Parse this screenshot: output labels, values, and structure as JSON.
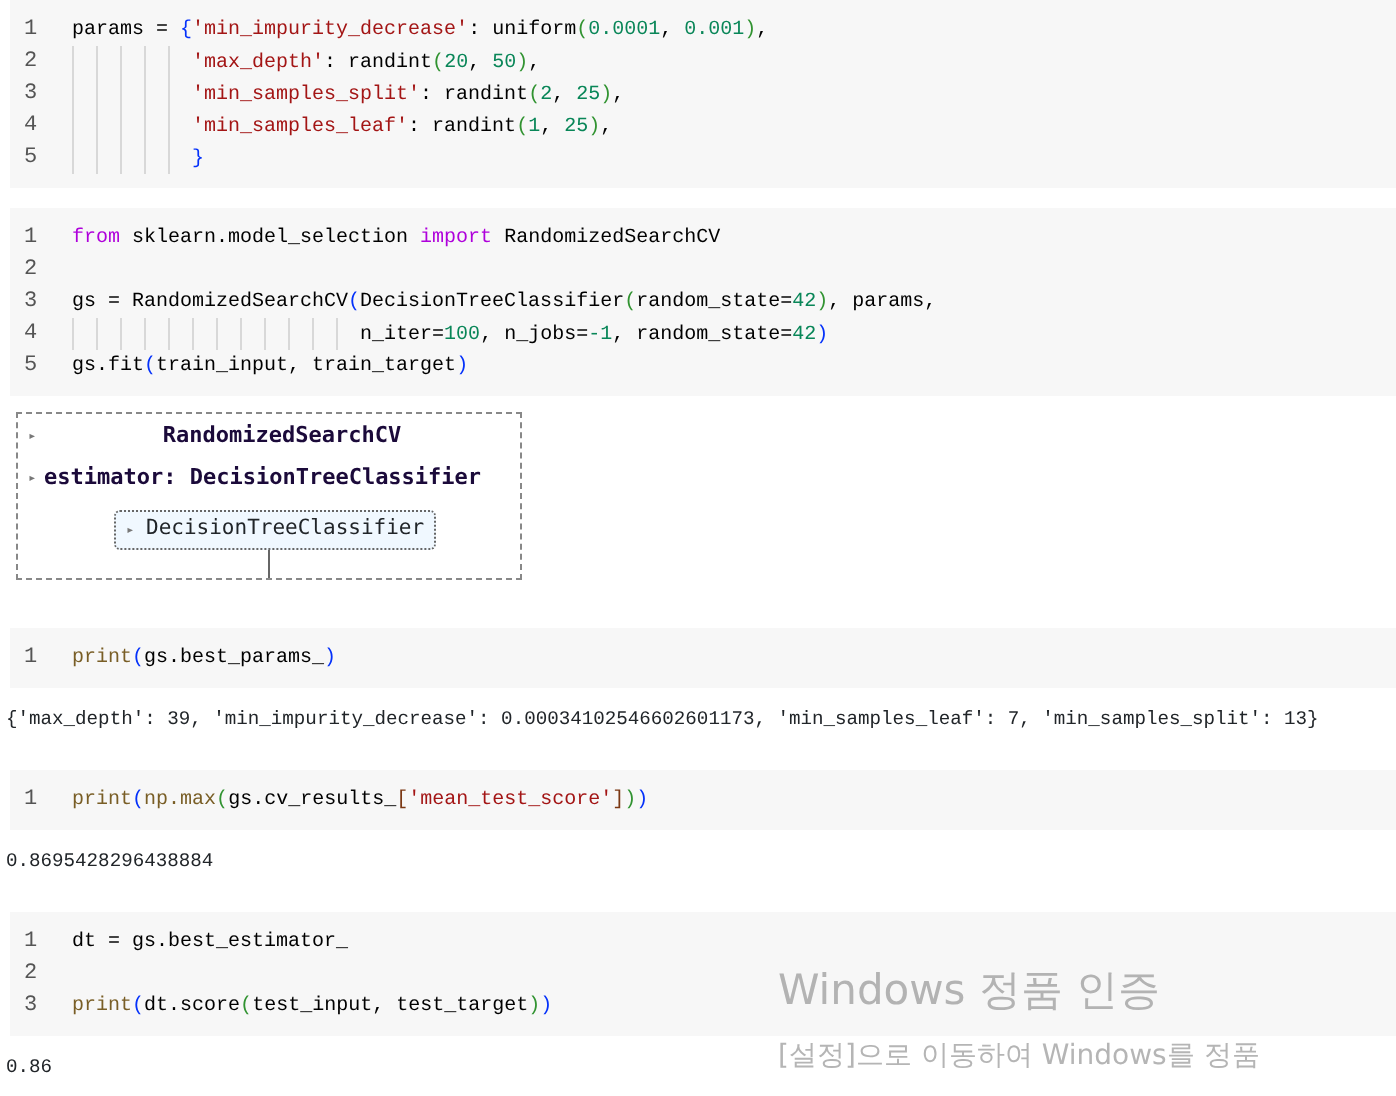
{
  "cells": [
    {
      "kind": "code",
      "lines": [
        {
          "num": "1",
          "tokens": [
            {
              "t": "params = ",
              "kind": "plain"
            },
            {
              "t": "{",
              "kind": "p1"
            },
            {
              "t": "'min_impurity_decrease'",
              "kind": "str"
            },
            {
              "t": ": uniform",
              "kind": "plain"
            },
            {
              "t": "(",
              "kind": "p2"
            },
            {
              "t": "0.0001",
              "kind": "num"
            },
            {
              "t": ", ",
              "kind": "plain"
            },
            {
              "t": "0.001",
              "kind": "num"
            },
            {
              "t": ")",
              "kind": "p2"
            },
            {
              "t": ",",
              "kind": "plain"
            }
          ]
        },
        {
          "num": "2",
          "tokens": [
            {
              "t": "          'max_depth'",
              "kind": "str"
            },
            {
              "t": ": randint",
              "kind": "plain"
            },
            {
              "t": "(",
              "kind": "p2"
            },
            {
              "t": "20",
              "kind": "num"
            },
            {
              "t": ", ",
              "kind": "plain"
            },
            {
              "t": "50",
              "kind": "num"
            },
            {
              "t": ")",
              "kind": "p2"
            },
            {
              "t": ",",
              "kind": "plain"
            }
          ]
        },
        {
          "num": "3",
          "tokens": [
            {
              "t": "          'min_samples_split'",
              "kind": "str"
            },
            {
              "t": ": randint",
              "kind": "plain"
            },
            {
              "t": "(",
              "kind": "p2"
            },
            {
              "t": "2",
              "kind": "num"
            },
            {
              "t": ", ",
              "kind": "plain"
            },
            {
              "t": "25",
              "kind": "num"
            },
            {
              "t": ")",
              "kind": "p2"
            },
            {
              "t": ",",
              "kind": "plain"
            }
          ]
        },
        {
          "num": "4",
          "tokens": [
            {
              "t": "          'min_samples_leaf'",
              "kind": "str"
            },
            {
              "t": ": randint",
              "kind": "plain"
            },
            {
              "t": "(",
              "kind": "p2"
            },
            {
              "t": "1",
              "kind": "num"
            },
            {
              "t": ", ",
              "kind": "plain"
            },
            {
              "t": "25",
              "kind": "num"
            },
            {
              "t": ")",
              "kind": "p2"
            },
            {
              "t": ",",
              "kind": "plain"
            }
          ]
        },
        {
          "num": "5",
          "tokens": [
            {
              "t": "          }",
              "kind": "p1"
            }
          ]
        }
      ]
    },
    {
      "kind": "code",
      "lines": [
        {
          "num": "1",
          "tokens": [
            {
              "t": "from",
              "kind": "kw"
            },
            {
              "t": " sklearn.model_selection ",
              "kind": "plain"
            },
            {
              "t": "import",
              "kind": "kw"
            },
            {
              "t": " RandomizedSearchCV",
              "kind": "plain"
            }
          ]
        },
        {
          "num": "2"
        },
        {
          "num": "3",
          "tokens": [
            {
              "t": "gs = RandomizedSearchCV",
              "kind": "plain"
            },
            {
              "t": "(",
              "kind": "p1"
            },
            {
              "t": "DecisionTreeClassifier",
              "kind": "plain"
            },
            {
              "t": "(",
              "kind": "p2"
            },
            {
              "t": "random_state=",
              "kind": "plain"
            },
            {
              "t": "42",
              "kind": "num"
            },
            {
              "t": ")",
              "kind": "p2"
            },
            {
              "t": ", params,",
              "kind": "plain"
            }
          ]
        },
        {
          "num": "4",
          "tokens": [
            {
              "t": "                        n_iter=",
              "kind": "plain"
            },
            {
              "t": "100",
              "kind": "num"
            },
            {
              "t": ", n_jobs=",
              "kind": "plain"
            },
            {
              "t": "-1",
              "kind": "num"
            },
            {
              "t": ", random_state=",
              "kind": "plain"
            },
            {
              "t": "42",
              "kind": "num"
            },
            {
              "t": ")",
              "kind": "p1"
            }
          ]
        },
        {
          "num": "5",
          "tokens": [
            {
              "t": "gs.fit",
              "kind": "plain"
            },
            {
              "t": "(",
              "kind": "p1"
            },
            {
              "t": "train_input, train_target",
              "kind": "plain"
            },
            {
              "t": ")",
              "kind": "p1"
            }
          ]
        }
      ]
    },
    {
      "kind": "estimator",
      "title_toggle": "▸",
      "title": "RandomizedSearchCV",
      "estimator_toggle": "▸",
      "estimator": "estimator: DecisionTreeClassifier",
      "inner_toggle": "▸",
      "inner": "DecisionTreeClassifier"
    },
    {
      "kind": "code",
      "lines": [
        {
          "num": "1",
          "tokens": [
            {
              "t": "print",
              "kind": "fn"
            },
            {
              "t": "(",
              "kind": "p1"
            },
            {
              "t": "gs.best_params_",
              "kind": "plain"
            },
            {
              "t": ")",
              "kind": "p1"
            }
          ]
        }
      ]
    },
    {
      "kind": "output",
      "text": "{'max_depth': 39, 'min_impurity_decrease': 0.00034102546602601173, 'min_samples_leaf': 7, 'min_samples_split': 13}"
    },
    {
      "kind": "code",
      "lines": [
        {
          "num": "1",
          "tokens": [
            {
              "t": "print",
              "kind": "fn"
            },
            {
              "t": "(",
              "kind": "p1"
            },
            {
              "t": "np.max",
              "kind": "fn"
            },
            {
              "t": "(",
              "kind": "p2"
            },
            {
              "t": "gs.cv_results_",
              "kind": "plain"
            },
            {
              "t": "[",
              "kind": "p3"
            },
            {
              "t": "'mean_test_score'",
              "kind": "str"
            },
            {
              "t": "]",
              "kind": "p3"
            },
            {
              "t": ")",
              "kind": "p2"
            },
            {
              "t": ")",
              "kind": "p1"
            }
          ]
        }
      ]
    },
    {
      "kind": "output",
      "text": "0.8695428296438884"
    },
    {
      "kind": "code",
      "lines": [
        {
          "num": "1",
          "tokens": [
            {
              "t": "dt = gs.best_estimator_",
              "kind": "plain"
            }
          ]
        },
        {
          "num": "2"
        },
        {
          "num": "3",
          "tokens": [
            {
              "t": "print",
              "kind": "fn"
            },
            {
              "t": "(",
              "kind": "p1"
            },
            {
              "t": "dt.score",
              "kind": "plain"
            },
            {
              "t": "(",
              "kind": "p2"
            },
            {
              "t": "test_input, test_target",
              "kind": "plain"
            },
            {
              "t": ")",
              "kind": "p2"
            },
            {
              "t": ")",
              "kind": "p1"
            }
          ]
        }
      ]
    },
    {
      "kind": "output",
      "text": "0.86"
    }
  ],
  "activation_notice": {
    "title": "Windows 정품 인증",
    "subtitle": "[설정]으로 이동하여 Windows를 정품"
  }
}
